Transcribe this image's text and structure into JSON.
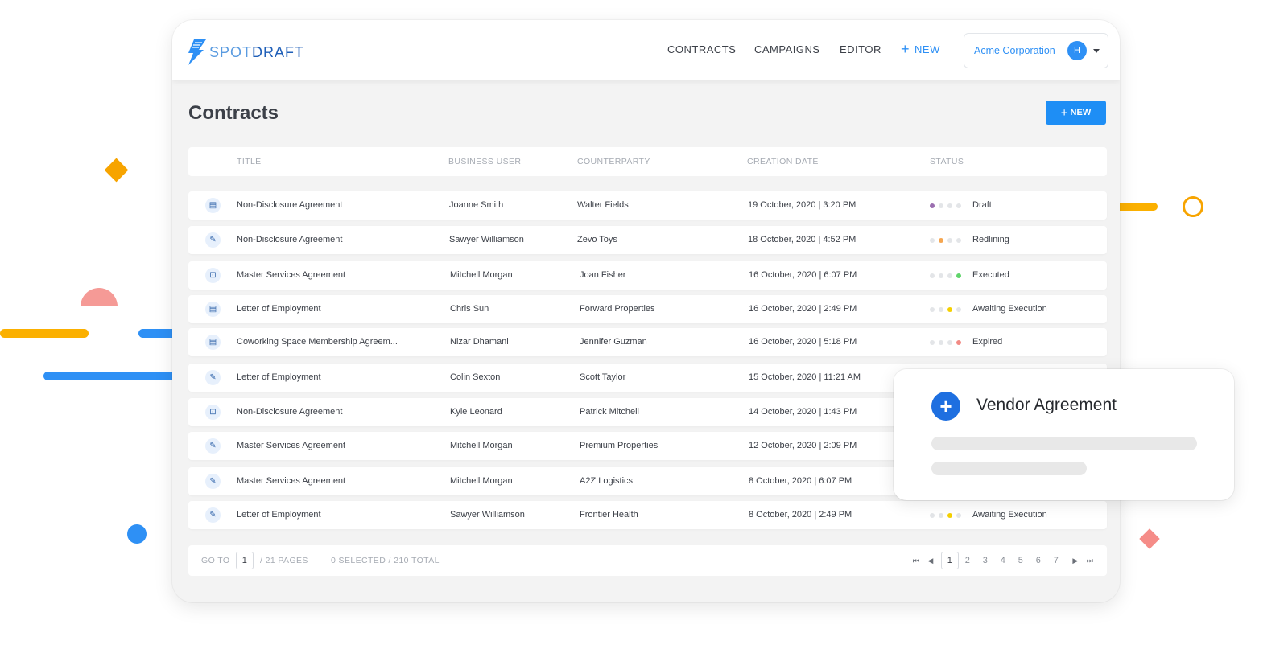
{
  "brand": {
    "name_light": "SPOT",
    "name_dark": "DRAFT"
  },
  "nav": {
    "contracts": "CONTRACTS",
    "campaigns": "CAMPAIGNS",
    "editor": "EDITOR",
    "new": "NEW"
  },
  "org": {
    "name": "Acme Corporation",
    "avatar_initial": "H"
  },
  "page": {
    "title": "Contracts",
    "new_button": "NEW"
  },
  "columns": {
    "title": "TITLE",
    "business_user": "BUSINESS USER",
    "counterparty": "COUNTERPARTY",
    "creation_date": "CREATION DATE",
    "status": "STATUS"
  },
  "rows": [
    {
      "icon": "document-list-icon",
      "title": "Non-Disclosure Agreement",
      "user": "Joanne Smith",
      "counterparty": "Walter Fields",
      "date": "19 October, 2020 | 3:20 PM",
      "status": "Draft",
      "stage": 0,
      "stage_color": "#9b6fb0"
    },
    {
      "icon": "pen-icon",
      "title": "Non-Disclosure Agreement",
      "user": "Sawyer Williamson",
      "counterparty": "Zevo Toys",
      "date": "18 October, 2020 | 4:52 PM",
      "status": "Redlining",
      "stage": 1,
      "stage_color": "#f5a650"
    },
    {
      "icon": "signature-doc-icon",
      "title": "Master Services Agreement",
      "user": "Mitchell Morgan",
      "counterparty": "Joan Fisher",
      "date": "16 October, 2020 | 6:07 PM",
      "status": "Executed",
      "stage": 3,
      "stage_color": "#5fd46a"
    },
    {
      "icon": "document-list-icon",
      "title": "Letter of Employment",
      "user": "Chris Sun",
      "counterparty": "Forward Properties",
      "date": "16 October, 2020 | 2:49 PM",
      "status": "Awaiting Execution",
      "stage": 2,
      "stage_color": "#f5d000"
    },
    {
      "icon": "document-list-icon",
      "title": "Coworking Space Membership Agreem...",
      "user": "Nizar Dhamani",
      "counterparty": "Jennifer Guzman",
      "date": "16 October, 2020 | 5:18 PM",
      "status": "Expired",
      "stage": 3,
      "stage_color": "#f28a84"
    },
    {
      "icon": "pen-icon",
      "title": "Letter of Employment",
      "user": "Colin Sexton",
      "counterparty": "Scott Taylor",
      "date": "15 October, 2020 | 11:21 AM",
      "status": "",
      "stage": -1,
      "stage_color": ""
    },
    {
      "icon": "signature-doc-icon",
      "title": "Non-Disclosure Agreement",
      "user": "Kyle Leonard",
      "counterparty": "Patrick Mitchell",
      "date": "14 October, 2020 | 1:43 PM",
      "status": "",
      "stage": -1,
      "stage_color": ""
    },
    {
      "icon": "pen-icon",
      "title": "Master Services Agreement",
      "user": "Mitchell Morgan",
      "counterparty": "Premium Properties",
      "date": "12 October, 2020 | 2:09 PM",
      "status": "",
      "stage": -1,
      "stage_color": ""
    },
    {
      "icon": "pen-icon",
      "title": "Master Services Agreement",
      "user": "Mitchell Morgan",
      "counterparty": "A2Z Logistics",
      "date": "8 October, 2020 | 6:07 PM",
      "status": "",
      "stage": -1,
      "stage_color": ""
    },
    {
      "icon": "pen-icon",
      "title": "Letter of Employment",
      "user": "Sawyer Williamson",
      "counterparty": "Frontier Health",
      "date": "8 October, 2020 | 2:49 PM",
      "status": "Awaiting Execution",
      "stage": 2,
      "stage_color": "#f5d000"
    }
  ],
  "footer": {
    "goto_label": "GO TO",
    "goto_value": "1",
    "pages": "/ 21 PAGES",
    "selected": "0 SELECTED / 210 TOTAL"
  },
  "pagination": {
    "current": "1",
    "pages": [
      "1",
      "2",
      "3",
      "4",
      "5",
      "6",
      "7"
    ]
  },
  "float_card": {
    "title": "Vendor Agreement"
  }
}
